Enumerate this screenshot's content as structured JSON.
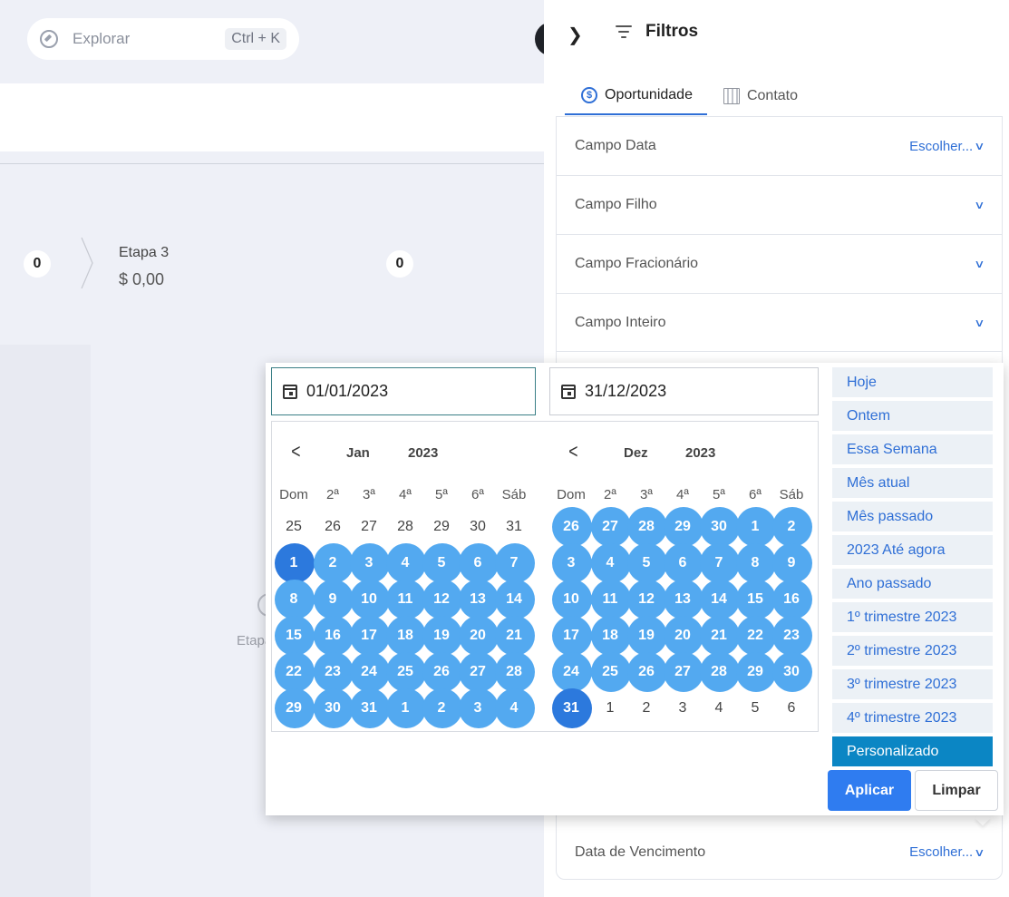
{
  "topbar": {
    "search_placeholder": "Explorar",
    "shortcut": "Ctrl + K"
  },
  "pipeline": {
    "left_count": "0",
    "stage_name": "Etapa 3",
    "stage_value": "$ 0,00",
    "right_count": "0",
    "ghost_label": "Etapa"
  },
  "panel": {
    "title": "Filtros",
    "tabs": [
      {
        "label": "Oportunidade",
        "icon": "dollar-icon"
      },
      {
        "label": "Contato",
        "icon": "building-icon"
      }
    ],
    "fields": [
      {
        "label": "Campo Data",
        "action": "Escolher..."
      },
      {
        "label": "Campo Filho",
        "action": ""
      },
      {
        "label": "Campo Fracionário",
        "action": ""
      },
      {
        "label": "Campo Inteiro",
        "action": ""
      },
      {
        "label": "Data de Vencimento",
        "action": "Escolher..."
      }
    ]
  },
  "datepicker": {
    "start_date": "01/01/2023",
    "end_date": "31/12/2023",
    "weekdays": [
      "Dom",
      "2ª",
      "3ª",
      "4ª",
      "5ª",
      "6ª",
      "Sáb"
    ],
    "months": [
      {
        "name": "Jan",
        "year": "2023",
        "days": [
          25,
          26,
          27,
          28,
          29,
          30,
          31,
          1,
          2,
          3,
          4,
          5,
          6,
          7,
          8,
          9,
          10,
          11,
          12,
          13,
          14,
          15,
          16,
          17,
          18,
          19,
          20,
          21,
          22,
          23,
          24,
          25,
          26,
          27,
          28,
          29,
          30,
          31,
          1,
          2,
          3,
          4
        ],
        "selected_from_index": 7,
        "selected_to_index": 41,
        "range_start_index": 7,
        "range_end_index": -1
      },
      {
        "name": "Dez",
        "year": "2023",
        "days": [
          26,
          27,
          28,
          29,
          30,
          1,
          2,
          3,
          4,
          5,
          6,
          7,
          8,
          9,
          10,
          11,
          12,
          13,
          14,
          15,
          16,
          17,
          18,
          19,
          20,
          21,
          22,
          23,
          24,
          25,
          26,
          27,
          28,
          29,
          30,
          31,
          1,
          2,
          3,
          4,
          5,
          6
        ],
        "selected_from_index": 0,
        "selected_to_index": 35,
        "range_start_index": -1,
        "range_end_index": 35
      }
    ],
    "presets": [
      "Hoje",
      "Ontem",
      "Essa Semana",
      "Mês atual",
      "Mês passado",
      "2023 Até agora",
      "Ano passado",
      "1º trimestre 2023",
      "2º trimestre 2023",
      "3º trimestre 2023",
      "4º trimestre 2023",
      "Personalizado"
    ],
    "active_preset": "Personalizado",
    "apply_label": "Aplicar",
    "clear_label": "Limpar"
  }
}
